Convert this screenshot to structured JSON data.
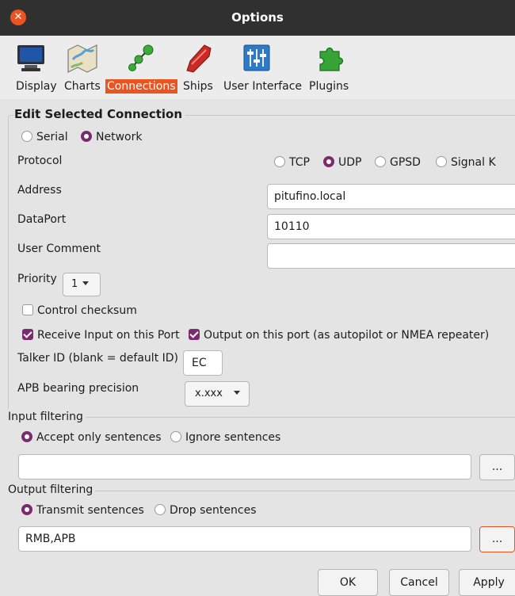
{
  "window": {
    "title": "Options"
  },
  "tabs": [
    {
      "label": "Display",
      "icon": "monitor-icon"
    },
    {
      "label": "Charts",
      "icon": "map-icon"
    },
    {
      "label": "Connections",
      "icon": "network-icon",
      "active": true
    },
    {
      "label": "Ships",
      "icon": "ship-icon"
    },
    {
      "label": "User Interface",
      "icon": "sliders-icon"
    },
    {
      "label": "Plugins",
      "icon": "puzzle-icon"
    }
  ],
  "edit": {
    "heading": "Edit Selected Connection",
    "type_serial": "Serial",
    "type_network": "Network",
    "protocol_label": "Protocol",
    "protocols": {
      "tcp": "TCP",
      "udp": "UDP",
      "gpsd": "GPSD",
      "signalk": "Signal K"
    },
    "address_label": "Address",
    "address_value": "pitufino.local",
    "dataport_label": "DataPort",
    "dataport_value": "10110",
    "comment_label": "User Comment",
    "comment_value": "",
    "priority_label": "Priority",
    "priority_value": "1",
    "control_checksum": "Control checksum",
    "receive_input": "Receive Input on this Port",
    "output_port": "Output on this port (as autopilot or NMEA repeater)",
    "talker_label": "Talker ID (blank = default ID)",
    "talker_value": "EC",
    "apb_label": "APB bearing precision",
    "apb_value": "x.xxx"
  },
  "input_filtering": {
    "title": "Input filtering",
    "accept": "Accept only sentences",
    "ignore": "Ignore sentences",
    "value": "",
    "browse": "..."
  },
  "output_filtering": {
    "title": "Output filtering",
    "transmit": "Transmit sentences",
    "drop": "Drop sentences",
    "value": "RMB,APB",
    "browse": "..."
  },
  "buttons": {
    "ok": "OK",
    "cancel": "Cancel",
    "apply": "Apply"
  },
  "colors": {
    "accent": "#e95420",
    "radio_checked": "#7a2b6d",
    "titlebar": "#303030"
  }
}
